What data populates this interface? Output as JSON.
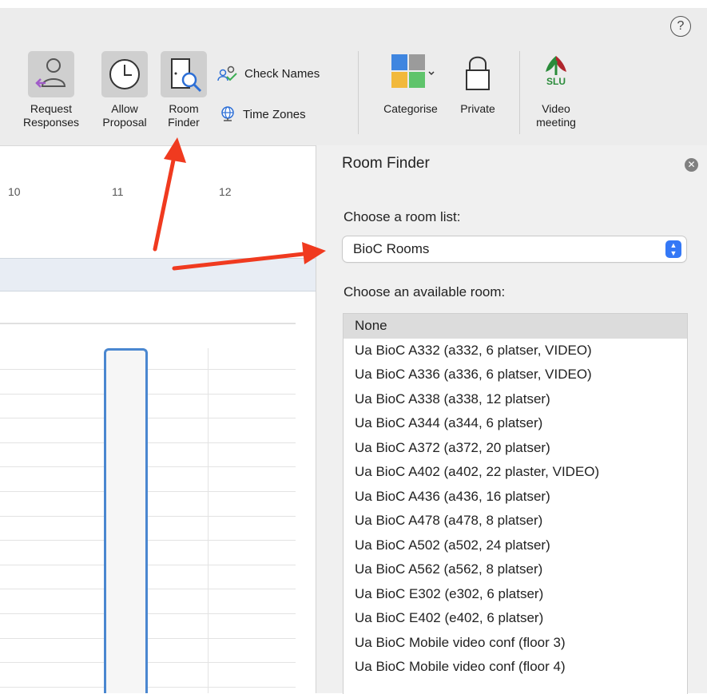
{
  "ribbon": {
    "help_label": "?",
    "request_responses": "Request\nResponses",
    "allow_proposal": "Allow\nProposal",
    "room_finder": "Room\nFinder",
    "check_names": "Check Names",
    "time_zones": "Time Zones",
    "categorise": "Categorise",
    "private": "Private",
    "video_meeting": "Video\nmeeting",
    "slu_logo_text": "SLU"
  },
  "calendar": {
    "columns": [
      "10",
      "11",
      "12"
    ]
  },
  "room_finder": {
    "title": "Room Finder",
    "choose_list_label": "Choose a room list:",
    "selected_list": "BioC Rooms",
    "choose_room_label": "Choose an available room:",
    "rooms": [
      "None",
      "Ua BioC A332 (a332, 6 platser, VIDEO)",
      "Ua BioC A336 (a336, 6 platser, VIDEO)",
      "Ua BioC A338 (a338, 12 platser)",
      "Ua BioC A344 (a344, 6 platser)",
      "Ua BioC A372 (a372, 20 platser)",
      "Ua BioC A402 (a402, 22 plaster, VIDEO)",
      "Ua BioC A436 (a436, 16 platser)",
      "Ua BioC A478 (a478, 8 platser)",
      "Ua BioC A502 (a502, 24 platser)",
      "Ua BioC A562 (a562, 8 platser)",
      "Ua BioC E302 (e302, 6 platser)",
      "Ua BioC E402 (e402, 6 platser)",
      "Ua BioC Mobile video conf (floor 3)",
      "Ua BioC Mobile video conf (floor 4)"
    ]
  },
  "colors": {
    "accent": "#3478f6",
    "annotation_arrow": "#f03a1f",
    "selection_border": "#4a87d0"
  }
}
